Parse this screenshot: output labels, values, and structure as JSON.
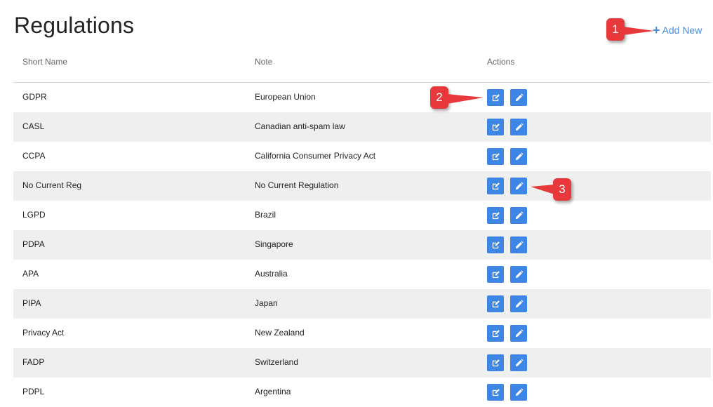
{
  "header": {
    "title": "Regulations",
    "add_new_label": "Add New"
  },
  "table": {
    "columns": [
      "Short Name",
      "Note",
      "Actions"
    ],
    "rows": [
      {
        "short_name": "GDPR",
        "note": "European Union"
      },
      {
        "short_name": "CASL",
        "note": "Canadian anti-spam law"
      },
      {
        "short_name": "CCPA",
        "note": "California Consumer Privacy Act"
      },
      {
        "short_name": "No Current Reg",
        "note": "No Current Regulation"
      },
      {
        "short_name": "LGPD",
        "note": "Brazil"
      },
      {
        "short_name": "PDPA",
        "note": "Singapore"
      },
      {
        "short_name": "APA",
        "note": "Australia"
      },
      {
        "short_name": "PIPA",
        "note": "Japan"
      },
      {
        "short_name": "Privacy Act",
        "note": "New Zealand"
      },
      {
        "short_name": "FADP",
        "note": "Switzerland"
      },
      {
        "short_name": "PDPL",
        "note": "Argentina"
      }
    ]
  },
  "callouts": {
    "one": "1",
    "two": "2",
    "three": "3"
  },
  "icons": {
    "add": "plus-icon",
    "edit": "edit-icon",
    "rename": "pencil-icon"
  },
  "colors": {
    "accent": "#3d86e6",
    "link": "#4a8cdb",
    "callout": "#e8383b",
    "row_alt": "#efefef"
  }
}
